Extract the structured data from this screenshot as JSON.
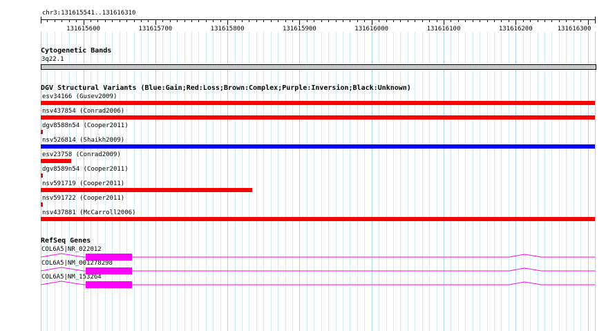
{
  "ruler": {
    "location": "chr3:131615541..131616310",
    "start": 131615541,
    "end": 131616310,
    "ticks": [
      "131615600",
      "131615700",
      "131615800",
      "131615900",
      "131616000",
      "131616100",
      "131616200",
      "131616300"
    ]
  },
  "cyto": {
    "title": "Cytogenetic Bands",
    "band": "3q22.1"
  },
  "dgv": {
    "title": "DGV Structural Variants (Blue:Gain;Red:Loss;Brown:Complex;Purple:Inversion;Black:Unknown)",
    "variants": [
      {
        "label": "esv34166 (Gusev2009)",
        "color": "#ff0000",
        "start": 131615541,
        "end": 131616310
      },
      {
        "label": "nsv437854 (Conrad2006)",
        "color": "#ff0000",
        "start": 131615541,
        "end": 131616310
      },
      {
        "label": "dgv8588n54 (Cooper2011)",
        "color": "#ff0000",
        "start": 131615541,
        "end": 131615543
      },
      {
        "label": "nsv526814 (Shaikh2009)",
        "color": "#0000ff",
        "start": 131615541,
        "end": 131616310
      },
      {
        "label": "esv23758 (Conrad2009)",
        "color": "#ff0000",
        "start": 131615541,
        "end": 131615583
      },
      {
        "label": "dgv8589n54 (Cooper2011)",
        "color": "#ff0000",
        "start": 131615541,
        "end": 131615543
      },
      {
        "label": "nsv591719 (Cooper2011)",
        "color": "#ff0000",
        "start": 131615541,
        "end": 131615834
      },
      {
        "label": "nsv591722 (Cooper2011)",
        "color": "#ff0000",
        "start": 131615541,
        "end": 131615543
      },
      {
        "label": "nsv437881 (McCarroll2006)",
        "color": "#ff0000",
        "start": 131615541,
        "end": 131616310
      }
    ]
  },
  "refseq": {
    "title": "RefSeq Genes",
    "color": "#ff00ff",
    "genes": [
      {
        "label": "COL6A5|NR_022012",
        "exon_start": 131615603,
        "exon_end": 131615667
      },
      {
        "label": "COL6A5|NM_001278298",
        "exon_start": 131615603,
        "exon_end": 131615667
      },
      {
        "label": "COL6A5|NM_153264",
        "exon_start": 131615603,
        "exon_end": 131615667
      }
    ]
  }
}
